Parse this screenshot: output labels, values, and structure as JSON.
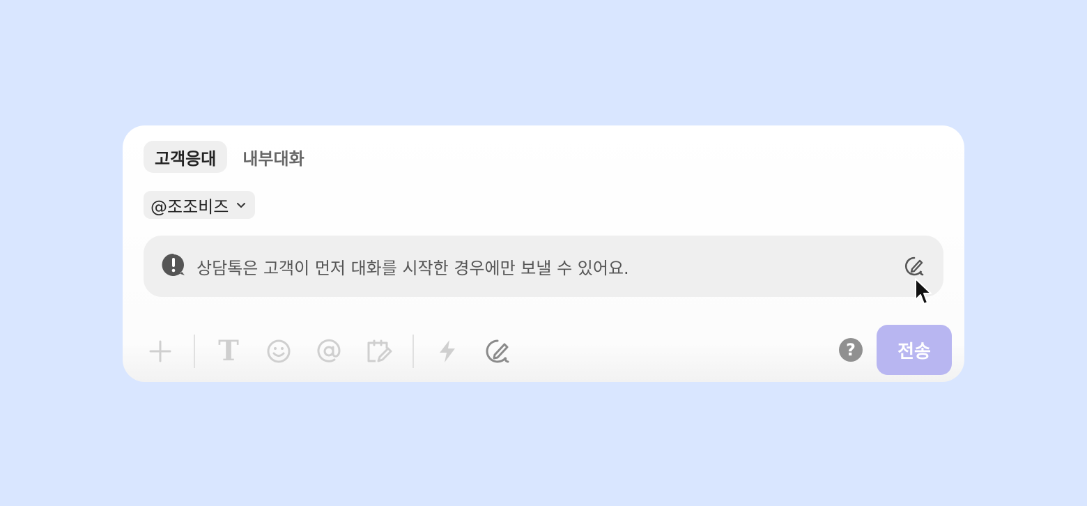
{
  "tabs": [
    {
      "label": "고객응대",
      "active": true
    },
    {
      "label": "내부대화",
      "active": false
    }
  ],
  "channel": {
    "label": "@조조비즈",
    "icon": "chevron-down-icon"
  },
  "notice": {
    "icon": "alert-bubble-icon",
    "text": "상담톡은 고객이 먼저 대화를 시작한 경우에만 보낼 수 있어요.",
    "action_icon": "ai-write-icon"
  },
  "toolbar": {
    "icons": [
      "plus-icon",
      "text-format-icon",
      "emoji-icon",
      "mention-icon",
      "snippet-icon",
      "lightning-icon",
      "ai-write-icon"
    ]
  },
  "help": {
    "label": "?"
  },
  "send": {
    "label": "전송"
  },
  "colors": {
    "background": "#d9e6ff",
    "send_button": "#b8b6f1",
    "disabled_icon": "#cfcfcf",
    "active_icon": "#8a8a8a"
  }
}
